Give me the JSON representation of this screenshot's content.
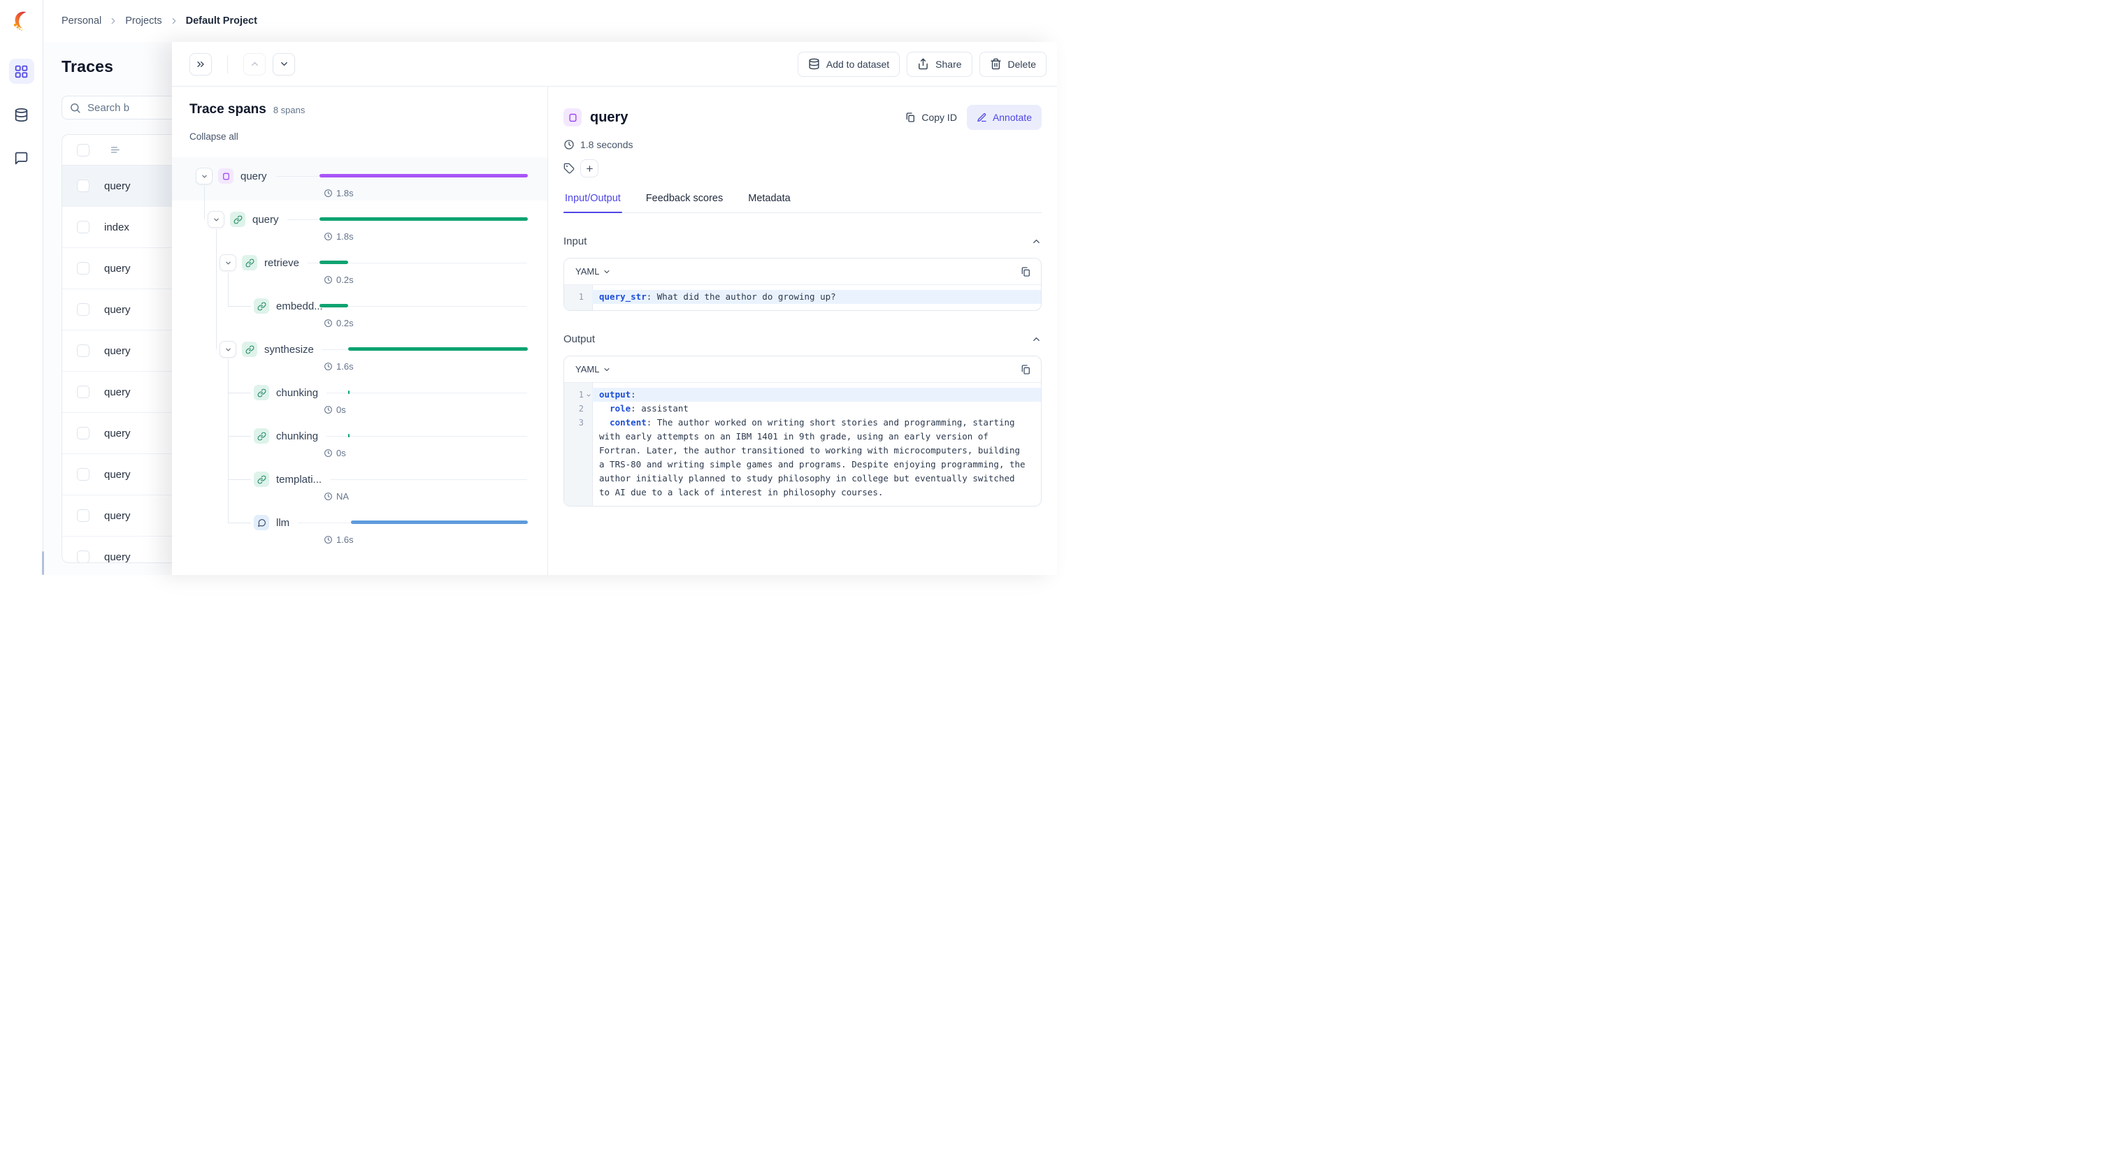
{
  "topbar": {
    "breadcrumb": [
      {
        "label": "Personal"
      },
      {
        "label": "Projects"
      },
      {
        "label": "Default Project"
      }
    ]
  },
  "sidebar": {
    "items": [
      {
        "icon": "grid-icon",
        "active": true
      },
      {
        "icon": "database-icon",
        "active": false
      },
      {
        "icon": "message-square-icon",
        "active": false
      }
    ]
  },
  "traces_panel": {
    "title": "Traces",
    "search_placeholder": "Search b",
    "rows": [
      {
        "label": "query",
        "selected": true
      },
      {
        "label": "index",
        "selected": false
      },
      {
        "label": "query",
        "selected": false
      },
      {
        "label": "query",
        "selected": false
      },
      {
        "label": "query",
        "selected": false
      },
      {
        "label": "query",
        "selected": false
      },
      {
        "label": "query",
        "selected": false
      },
      {
        "label": "query",
        "selected": false
      },
      {
        "label": "query",
        "selected": false
      },
      {
        "label": "query",
        "selected": false
      }
    ]
  },
  "toolbar": {
    "actions": [
      {
        "label": "Add to dataset",
        "icon": "database-icon"
      },
      {
        "label": "Share",
        "icon": "share-icon"
      },
      {
        "label": "Delete",
        "icon": "trash-icon"
      }
    ]
  },
  "spans_panel": {
    "title": "Trace spans",
    "count": "8 spans",
    "collapse_all": "Collapse all",
    "total_seconds": 1.8,
    "rows": [
      {
        "name": "query",
        "kind": "trace",
        "depth": 0,
        "chevron": true,
        "parent": null,
        "start_s": 0,
        "duration_s": 1.8,
        "duration_label": "1.8s",
        "selected": true,
        "bar_color": "#a855f7",
        "icon_bg": "#f3e8ff",
        "icon_color": "#9333ea"
      },
      {
        "name": "query",
        "kind": "chain",
        "depth": 1,
        "chevron": true,
        "parent": 0,
        "start_s": 0,
        "duration_s": 1.8,
        "duration_label": "1.8s",
        "selected": false,
        "bar_color": "#0ea371",
        "icon_bg": "#def3ea",
        "icon_color": "#15805c"
      },
      {
        "name": "retrieve",
        "kind": "chain",
        "depth": 2,
        "chevron": true,
        "parent": 1,
        "start_s": 0,
        "duration_s": 0.25,
        "duration_label": "0.2s",
        "selected": false,
        "bar_color": "#0ea371",
        "icon_bg": "#def3ea",
        "icon_color": "#15805c"
      },
      {
        "name": "embedd...",
        "kind": "chain",
        "depth": 3,
        "chevron": false,
        "parent": 2,
        "start_s": 0,
        "duration_s": 0.25,
        "duration_label": "0.2s",
        "selected": false,
        "bar_color": "#0ea371",
        "icon_bg": "#def3ea",
        "icon_color": "#15805c"
      },
      {
        "name": "synthesize",
        "kind": "chain",
        "depth": 2,
        "chevron": true,
        "parent": 1,
        "start_s": 0.25,
        "duration_s": 1.55,
        "duration_label": "1.6s",
        "selected": false,
        "bar_color": "#0ea371",
        "icon_bg": "#def3ea",
        "icon_color": "#15805c"
      },
      {
        "name": "chunking",
        "kind": "chain",
        "depth": 3,
        "chevron": false,
        "parent": 4,
        "start_s": 0.25,
        "duration_s": 0,
        "duration_label": "0s",
        "selected": false,
        "bar_color": "#0ea371",
        "icon_bg": "#def3ea",
        "icon_color": "#15805c"
      },
      {
        "name": "chunking",
        "kind": "chain",
        "depth": 3,
        "chevron": false,
        "parent": 4,
        "start_s": 0.25,
        "duration_s": 0,
        "duration_label": "0s",
        "selected": false,
        "bar_color": "#0ea371",
        "icon_bg": "#def3ea",
        "icon_color": "#15805c"
      },
      {
        "name": "templati...",
        "kind": "chain",
        "depth": 3,
        "chevron": false,
        "parent": 4,
        "start_s": null,
        "duration_s": null,
        "duration_label": "NA",
        "selected": false,
        "bar_color": "#0ea371",
        "icon_bg": "#def3ea",
        "icon_color": "#15805c"
      },
      {
        "name": "llm",
        "kind": "llm",
        "depth": 3,
        "chevron": false,
        "parent": 4,
        "start_s": 0.27,
        "duration_s": 1.53,
        "duration_label": "1.6s",
        "selected": false,
        "bar_color": "#5e9bdb",
        "icon_bg": "#e2eefb",
        "icon_color": "#33415c"
      }
    ]
  },
  "details": {
    "title": "query",
    "duration_text": "1.8 seconds",
    "copy_id_label": "Copy ID",
    "annotate_label": "Annotate",
    "tabs": [
      {
        "label": "Input/Output",
        "active": true
      },
      {
        "label": "Feedback scores",
        "active": false
      },
      {
        "label": "Metadata",
        "active": false
      }
    ],
    "input": {
      "section_label": "Input",
      "format_label": "YAML",
      "lines": [
        {
          "num": "1",
          "indent": "",
          "key": "query_str",
          "value": ": What did the author do growing up?",
          "highlight": true,
          "fold": false
        }
      ]
    },
    "output": {
      "section_label": "Output",
      "format_label": "YAML",
      "lines": [
        {
          "num": "1",
          "indent": "",
          "key": "output",
          "value": ":",
          "highlight": true,
          "fold": true
        },
        {
          "num": "2",
          "indent": "  ",
          "key": "role",
          "value": ": assistant",
          "highlight": false,
          "fold": false
        },
        {
          "num": "3",
          "indent": "  ",
          "key": "content",
          "value": ": The author worked on writing short stories and programming, starting with early attempts on an IBM 1401 in 9th grade, using an early version of Fortran. Later, the author transitioned to working with microcomputers, building a TRS-80 and writing simple games and programs. Despite enjoying programming, the author initially planned to study philosophy in college but eventually switched to AI due to a lack of interest in philosophy courses.",
          "highlight": false,
          "fold": false
        }
      ]
    }
  },
  "colors": {
    "accent": "#4f46e5",
    "purple_bar": "#a855f7",
    "green_bar": "#0ea371",
    "blue_bar": "#5e9bdb",
    "key_blue": "#1d4ed8"
  }
}
